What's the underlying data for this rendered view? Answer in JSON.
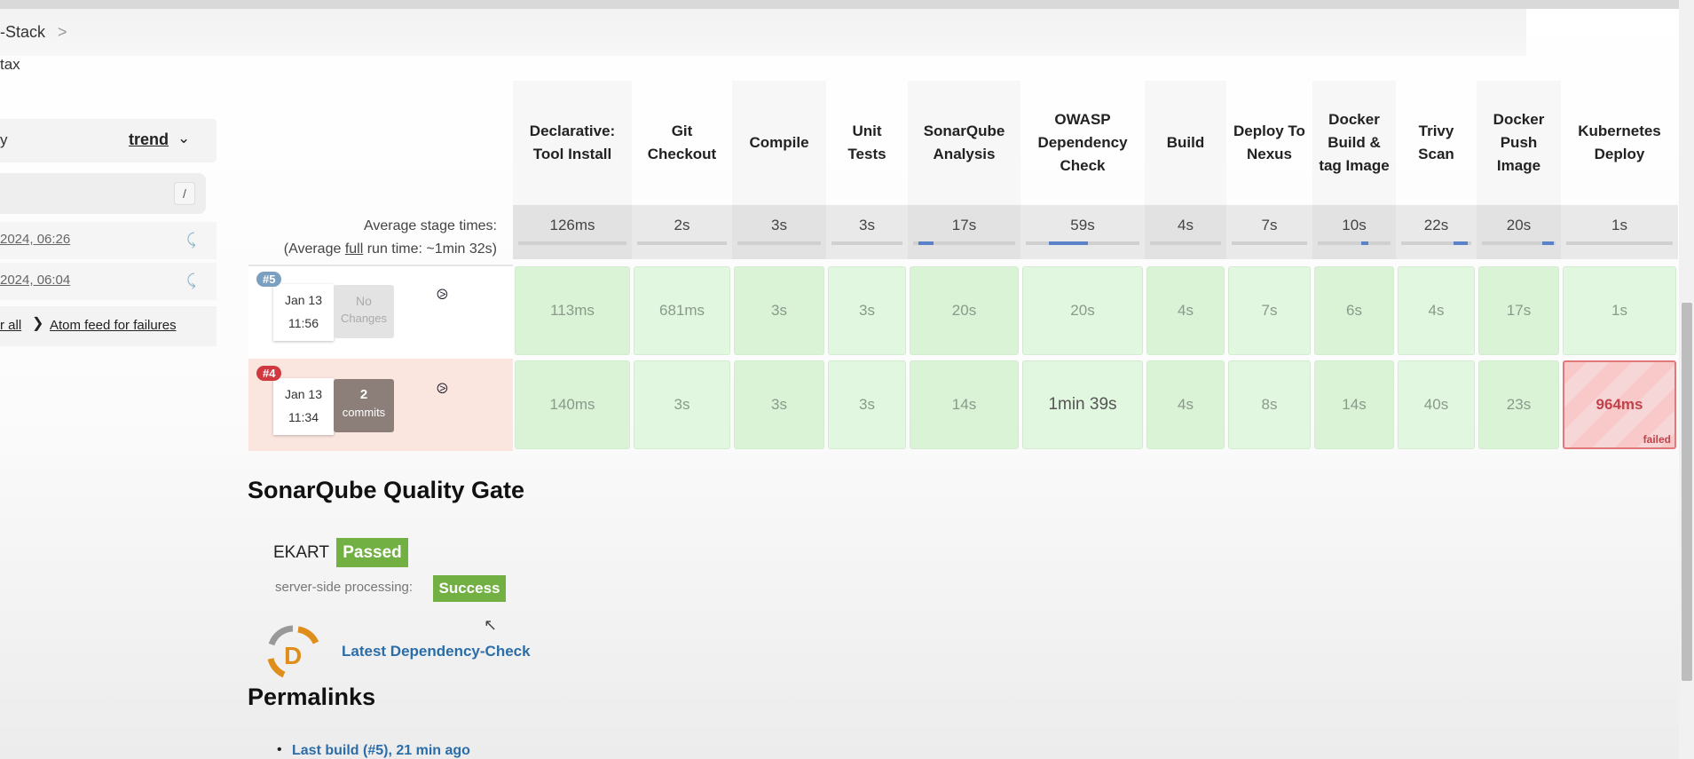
{
  "breadcrumb": {
    "item": "-Stack",
    "separator": ">"
  },
  "page_subtitle": "tax",
  "sidebar": {
    "trend_row": {
      "left_text": "y",
      "trend_label": "trend"
    },
    "search": {
      "shortcut": "/"
    },
    "history": [
      {
        "date": "2024, 06:26"
      },
      {
        "date": "2024, 06:04"
      }
    ],
    "feeds": {
      "all_label": "r all",
      "failures_label": "Atom feed for failures"
    }
  },
  "stage_view": {
    "avg_label": "Average stage times:",
    "avg_full_prefix": "(Average ",
    "avg_full_link": "full",
    "avg_full_suffix": " run time: ~1min 32s)",
    "stages": [
      {
        "name": "Declarative: Tool Install",
        "avg": "126ms"
      },
      {
        "name": "Git Checkout",
        "avg": "2s"
      },
      {
        "name": "Compile",
        "avg": "3s"
      },
      {
        "name": "Unit Tests",
        "avg": "3s"
      },
      {
        "name": "SonarQube Analysis",
        "avg": "17s",
        "highlight": true
      },
      {
        "name": "OWASP Dependency Check",
        "avg": "59s",
        "highlight": true
      },
      {
        "name": "Build",
        "avg": "4s"
      },
      {
        "name": "Deploy To Nexus",
        "avg": "7s"
      },
      {
        "name": "Docker Build & tag Image",
        "avg": "10s",
        "highlight": true
      },
      {
        "name": "Trivy Scan",
        "avg": "22s",
        "highlight": true
      },
      {
        "name": "Docker Push Image",
        "avg": "20s",
        "highlight": true
      },
      {
        "name": "Kubernetes Deploy",
        "avg": "1s"
      }
    ],
    "builds": [
      {
        "number": "#5",
        "date": "Jan 13",
        "time": "11:56",
        "changes_line1": "No",
        "changes_line2": "Changes",
        "status": "success",
        "badge_color": "#7a9fc0",
        "times": [
          "113ms",
          "681ms",
          "3s",
          "3s",
          "20s",
          "20s",
          "4s",
          "7s",
          "6s",
          "4s",
          "17s",
          "1s"
        ]
      },
      {
        "number": "#4",
        "date": "Jan 13",
        "time": "11:34",
        "changes_line1": "2",
        "changes_line2": "commits",
        "status": "failed",
        "badge_color": "#d0393f",
        "times": [
          "140ms",
          "3s",
          "3s",
          "3s",
          "14s",
          "1min 39s",
          "4s",
          "8s",
          "14s",
          "40s",
          "23s",
          "964ms"
        ],
        "failed_stage_label": "failed"
      }
    ]
  },
  "sonarqube": {
    "title": "SonarQube Quality Gate",
    "project": "EKART",
    "status": "Passed",
    "processing_label": "server-side processing:",
    "processing_status": "Success",
    "status_color": "#72b043"
  },
  "dependency_check": {
    "link": "Latest Dependency-Check",
    "logo_letter": "D"
  },
  "permalinks": {
    "title": "Permalinks",
    "items": [
      "Last build (#5), 21 min ago"
    ]
  }
}
